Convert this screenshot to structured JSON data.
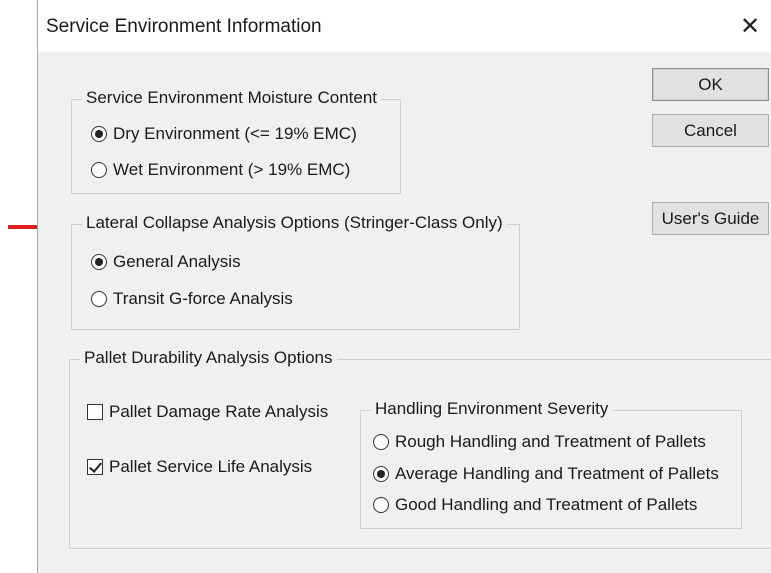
{
  "window": {
    "title": "Service Environment Information",
    "close_glyph": "✕"
  },
  "buttons": {
    "ok": "OK",
    "cancel": "Cancel",
    "users_guide": "User's Guide"
  },
  "moisture": {
    "legend": "Service Environment Moisture Content",
    "options": [
      {
        "label": "Dry Environment (<= 19% EMC)",
        "selected": true
      },
      {
        "label": "Wet Environment (> 19% EMC)",
        "selected": false
      }
    ]
  },
  "lateral": {
    "legend": "Lateral Collapse Analysis Options  (Stringer-Class Only)",
    "options": [
      {
        "label": "General Analysis",
        "selected": true
      },
      {
        "label": "Transit G-force Analysis",
        "selected": false
      }
    ]
  },
  "durability": {
    "legend": "Pallet Durability Analysis Options",
    "checks": [
      {
        "label": "Pallet Damage Rate Analysis",
        "checked": false
      },
      {
        "label": "Pallet Service Life Analysis",
        "checked": true
      }
    ],
    "severity": {
      "legend": "Handling Environment Severity",
      "options": [
        {
          "label": "Rough Handling and Treatment of Pallets",
          "selected": false
        },
        {
          "label": "Average Handling and Treatment of Pallets",
          "selected": true
        },
        {
          "label": "Good Handling and Treatment of Pallets",
          "selected": false
        }
      ]
    }
  },
  "annotation": {
    "arrow_color": "#e02020",
    "icon": "arrow-right-icon"
  }
}
